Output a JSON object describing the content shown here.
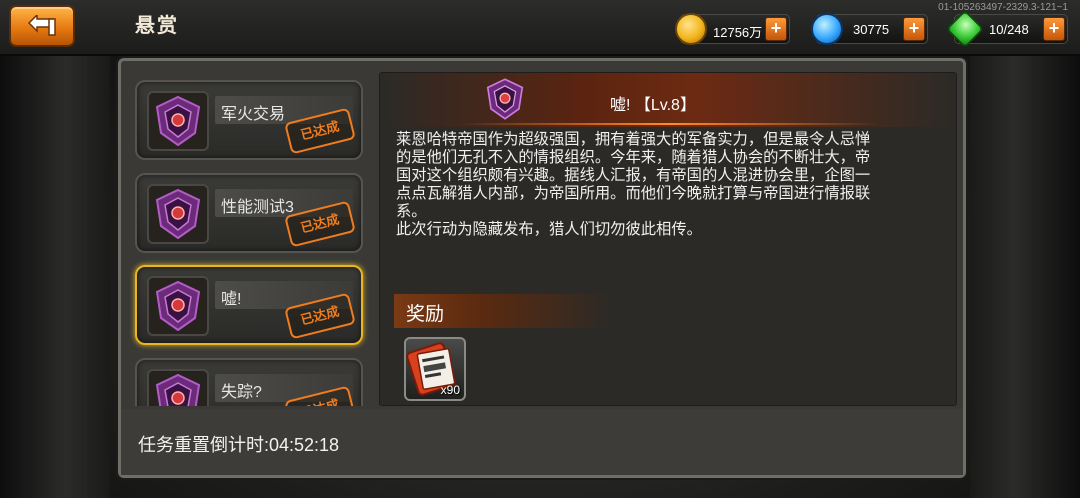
{
  "header": {
    "title": "悬赏",
    "build_id": "01-105263497-2329.3-121~1"
  },
  "resources": {
    "gold": {
      "value": "12756万",
      "icon": "gold-coin-icon",
      "color": "#f2b51c"
    },
    "diamond": {
      "value": "30775",
      "icon": "blue-diamond-icon",
      "color": "#35a7ff"
    },
    "energy": {
      "value": "10/248",
      "icon": "green-crystal-icon",
      "color": "#3fcf3b"
    },
    "plus_label": "+"
  },
  "quests": [
    {
      "name": "军火交易",
      "status": "已达成",
      "active": false
    },
    {
      "name": "性能测试3",
      "status": "已达成",
      "active": false
    },
    {
      "name": "嘘!",
      "status": "已达成",
      "active": true
    },
    {
      "name": "失踪?",
      "status": "已达成",
      "active": false
    }
  ],
  "detail": {
    "title": "嘘! 【Lv.8】",
    "description_lines": [
      "莱恩哈特帝国作为超级强国，拥有着强大的军备实力，但是最令人忌惮",
      "的是他们无孔不入的情报组织。今年来，随着猎人协会的不断壮大，帝",
      "国对这个组织颇有兴趣。据线人汇报，有帝国的人混进协会里，企图一",
      "点点瓦解猎人内部，为帝国所用。而他们今晚就打算与帝国进行情报联",
      "系。",
      "此次行动为隐藏发布，猎人们切勿彼此相传。"
    ],
    "reward_label": "奖励",
    "reward": {
      "icon": "ticket-scroll-icon",
      "quantity": "x90"
    }
  },
  "footer": {
    "countdown": "任务重置倒计时:04:52:18"
  },
  "colors": {
    "accent_orange": "#ef7d1f",
    "active_border": "#e8b622"
  }
}
